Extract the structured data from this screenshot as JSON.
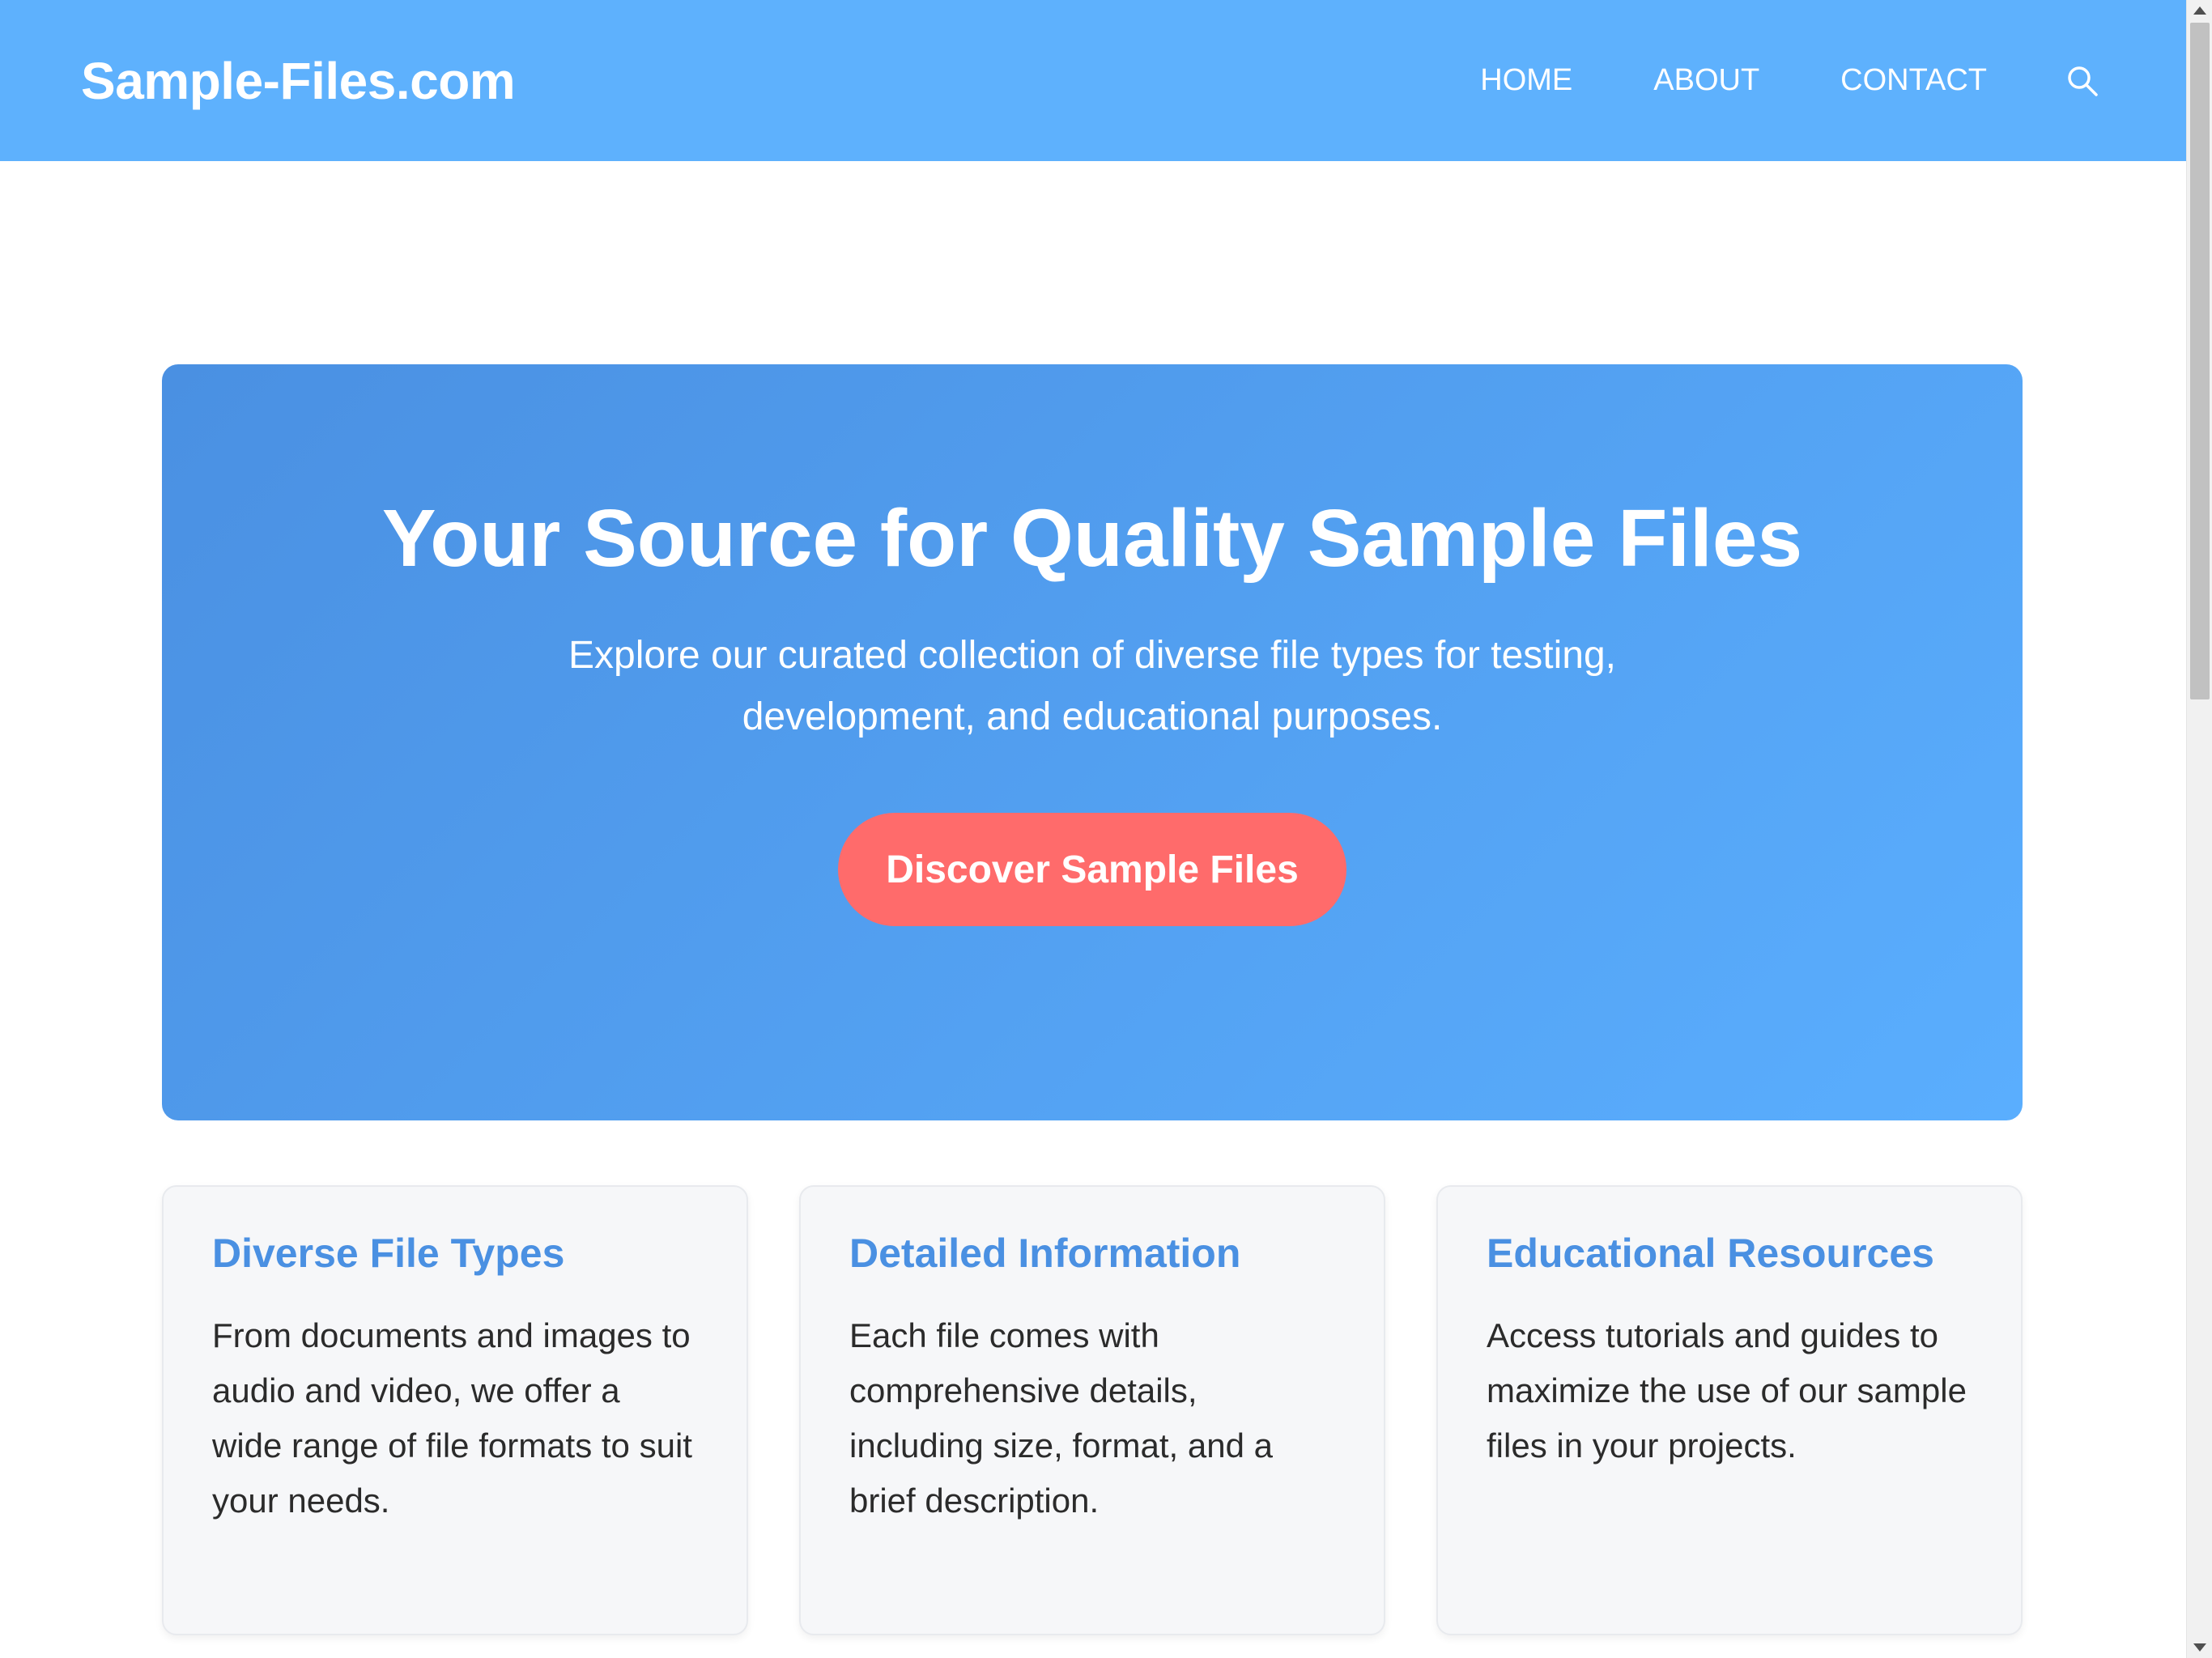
{
  "header": {
    "logo": "Sample-Files.com",
    "nav": [
      {
        "label": "HOME"
      },
      {
        "label": "ABOUT"
      },
      {
        "label": "CONTACT"
      }
    ],
    "search_icon": "search-icon"
  },
  "hero": {
    "title": "Your Source for Quality Sample Files",
    "subtitle": "Explore our curated collection of diverse file types for testing, development, and educational purposes.",
    "cta_label": "Discover Sample Files"
  },
  "features": [
    {
      "title": "Diverse File Types",
      "text": "From documents and images to audio and video, we offer a wide range of file formats to suit your needs."
    },
    {
      "title": "Detailed Information",
      "text": "Each file comes with comprehensive details, including size, format, and a brief description."
    },
    {
      "title": "Educational Resources",
      "text": "Access tutorials and guides to maximize the use of our sample files in your projects."
    }
  ],
  "colors": {
    "header_bg": "#5eb1fd",
    "hero_gradient_start": "#4a90e2",
    "hero_gradient_end": "#5aaefe",
    "cta_bg": "#ff6b6b",
    "feature_title": "#4a90e2",
    "card_bg": "#f6f7f9"
  }
}
